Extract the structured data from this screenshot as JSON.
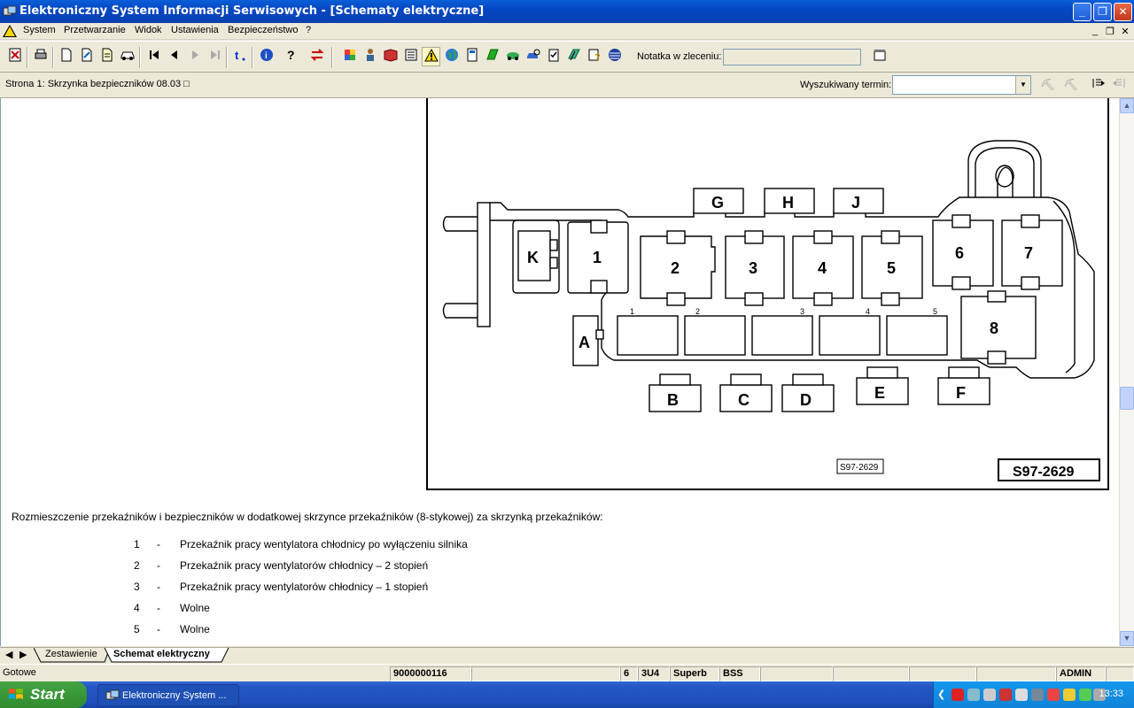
{
  "window": {
    "title": "Elektroniczny System Informacji Serwisowych - [Schematy elektryczne]",
    "app_icon": "esi-app-icon"
  },
  "menu": {
    "items": [
      "System",
      "Przetwarzanie",
      "Widok",
      "Ustawienia",
      "Bezpieczeństwo",
      "?"
    ]
  },
  "toolbar": {
    "notatka_label": "Notatka w zleceniu:",
    "notatka_value": ""
  },
  "pagebar": {
    "page_label": "Strona 1: Skrzynka bezpieczników 08.03 □",
    "search_label": "Wyszukiwany termin:",
    "search_value": ""
  },
  "diagram": {
    "code_small": "S97-2629",
    "code_large": "S97-2629",
    "top_connectors": [
      "G",
      "H",
      "J"
    ],
    "relays_top": [
      "1",
      "2",
      "3",
      "4",
      "5",
      "6",
      "7"
    ],
    "relay_8": "8",
    "side_connectors": [
      "K",
      "A"
    ],
    "bottom_connectors": [
      "B",
      "C",
      "D",
      "E",
      "F"
    ],
    "fuse_labels": [
      "1",
      "2",
      "3",
      "4",
      "5"
    ]
  },
  "content": {
    "description": "Rozmieszczenie przekaźników i bezpieczników w dodatkowej skrzynce przekaźników (8-stykowej) za skrzynką przekaźników:",
    "list": [
      {
        "num": "1",
        "dash": "-",
        "text": "Przekaźnik pracy wentylatora chłodnicy po wyłączeniu silnika"
      },
      {
        "num": "2",
        "dash": "-",
        "text": "Przekaźnik pracy wentylatorów chłodnicy – 2 stopień"
      },
      {
        "num": "3",
        "dash": "-",
        "text": "Przekaźnik pracy wentylatorów chłodnicy – 1 stopień"
      },
      {
        "num": "4",
        "dash": "-",
        "text": "Wolne"
      },
      {
        "num": "5",
        "dash": "-",
        "text": "Wolne"
      }
    ]
  },
  "tabs": {
    "items": [
      "Zestawienie",
      "Schemat elektryczny"
    ],
    "active": "Schemat elektryczny"
  },
  "status": {
    "ready": "Gotowe",
    "order_no": "9000000116",
    "f1": "6",
    "f2": "3U4",
    "f3": "Superb",
    "f4": "BSS",
    "user": "ADMIN"
  },
  "taskbar": {
    "start_label": "Start",
    "app_label": "Elektroniczny System ...",
    "clock": "13:33"
  },
  "colors": {
    "titlebar": "#0446c2",
    "taskbar": "#2456c4",
    "start": "#3b9a39",
    "tray": "#1597ec"
  }
}
